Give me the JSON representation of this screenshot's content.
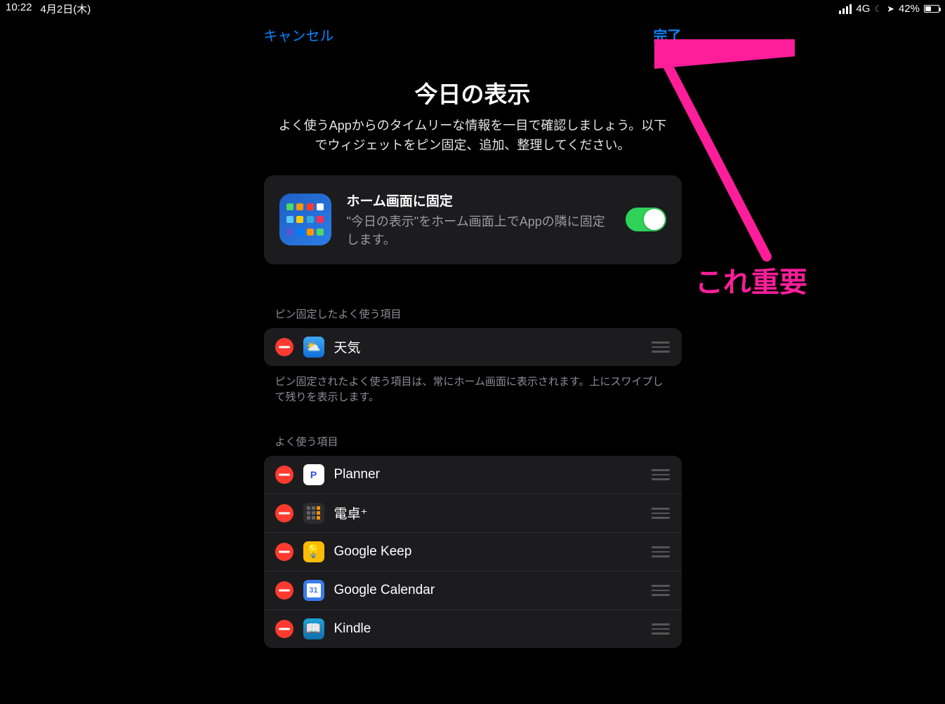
{
  "status": {
    "time": "10:22",
    "date": "4月2日(木)",
    "network": "4G",
    "battery_pct": "42%"
  },
  "nav": {
    "cancel": "キャンセル",
    "done": "完了"
  },
  "header": {
    "title": "今日の表示",
    "desc": "よく使うAppからのタイムリーな情報を一目で確認しましょう。以下でウィジェットをピン固定、追加、整理してください。"
  },
  "pin_card": {
    "title": "ホーム画面に固定",
    "desc": "\"今日の表示\"をホーム画面上でAppの隣に固定します。",
    "enabled": true
  },
  "sections": {
    "pinned": {
      "header": "ピン固定したよく使う項目",
      "footer": "ピン固定されたよく使う項目は、常にホーム画面に表示されます。上にスワイプして残りを表示します。",
      "items": [
        {
          "label": "天気",
          "icon": "weather"
        }
      ]
    },
    "favorites": {
      "header": "よく使う項目",
      "items": [
        {
          "label": "Planner",
          "icon": "planner"
        },
        {
          "label": "電卓⁺",
          "icon": "calc"
        },
        {
          "label": "Google Keep",
          "icon": "keep"
        },
        {
          "label": "Google Calendar",
          "icon": "gcal"
        },
        {
          "label": "Kindle",
          "icon": "kindle"
        }
      ]
    }
  },
  "annotation": {
    "text": "これ重要",
    "color": "#ff1e9a"
  }
}
